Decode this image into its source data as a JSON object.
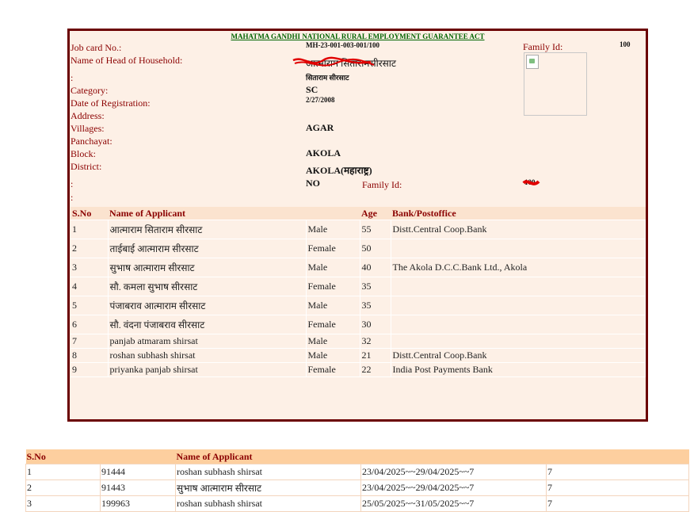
{
  "card": {
    "act_title": "MAHATMA GANDHI NATIONAL RURAL EMPLOYMENT GUARANTEE ACT",
    "labels": {
      "job_card": "Job card No.:",
      "head": "Name of Head of Household:",
      "colon1": ":",
      "category": "Category:",
      "registration": "Date of Registration:",
      "address": "Address:",
      "villages": "Villages:",
      "panchayat": "Panchayat:",
      "block": "Block:",
      "district": "District:",
      "colon2": ":",
      "colon3": ":"
    },
    "values": {
      "job_card": "MH-23-001-003-001/100",
      "head": "आत्माराम सितारामसीरसाट",
      "father": "सिताराम सीरसाट",
      "category": "SC",
      "registration": "2/27/2008",
      "village": "AGAR",
      "block": "AKOLA",
      "district": "AKOLA(महाराष्ट्र)",
      "bpl": "NO"
    },
    "family_id_label": "Family Id:",
    "family_id_value": "100",
    "family_id_label_2": "Family Id:",
    "family_id_value_2": "100"
  },
  "applicants": {
    "headers": [
      "S.No",
      "Name of Applicant",
      "",
      "Age",
      "Bank/Postoffice"
    ],
    "rows": [
      {
        "sno": "1",
        "name": "आत्माराम सिताराम सीरसाट",
        "gender": "Male",
        "age": "55",
        "bank": "Distt.Central Coop.Bank"
      },
      {
        "sno": "2",
        "name": "ताईबाई आत्माराम सीरसाट",
        "gender": "Female",
        "age": "50",
        "bank": ""
      },
      {
        "sno": "3",
        "name": "सुभाष आत्माराम सीरसाट",
        "gender": "Male",
        "age": "40",
        "bank": "The Akola D.C.C.Bank Ltd., Akola"
      },
      {
        "sno": "4",
        "name": "सौ. कमला सुभाष सीरसाट",
        "gender": "Female",
        "age": "35",
        "bank": ""
      },
      {
        "sno": "5",
        "name": "पंजाबराव आत्माराम सीरसाट",
        "gender": "Male",
        "age": "35",
        "bank": ""
      },
      {
        "sno": "6",
        "name": "सौ. वंदना पंजाबराव सीरसाट",
        "gender": "Female",
        "age": "30",
        "bank": ""
      },
      {
        "sno": "7",
        "name": "panjab atmaram shirsat",
        "gender": "Male",
        "age": "32",
        "bank": ""
      },
      {
        "sno": "8",
        "name": "roshan subhash shirsat",
        "gender": "Male",
        "age": "21",
        "bank": "Distt.Central Coop.Bank"
      },
      {
        "sno": "9",
        "name": "priyanka panjab shirsat",
        "gender": "Female",
        "age": "22",
        "bank": "India Post Payments Bank"
      }
    ]
  },
  "work": {
    "headers": [
      "S.No",
      "",
      "Name of Applicant",
      "",
      ""
    ],
    "rows": [
      {
        "sno": "1",
        "id": "91444",
        "name": "roshan subhash shirsat",
        "period": "23/04/2025~~29/04/2025~~7",
        "days": "7"
      },
      {
        "sno": "2",
        "id": "91443",
        "name": "सुभाष आत्माराम सीरसाट",
        "period": "23/04/2025~~29/04/2025~~7",
        "days": "7"
      },
      {
        "sno": "3",
        "id": "199963",
        "name": "roshan subhash shirsat",
        "period": "25/05/2025~~31/05/2025~~7",
        "days": "7"
      }
    ]
  }
}
